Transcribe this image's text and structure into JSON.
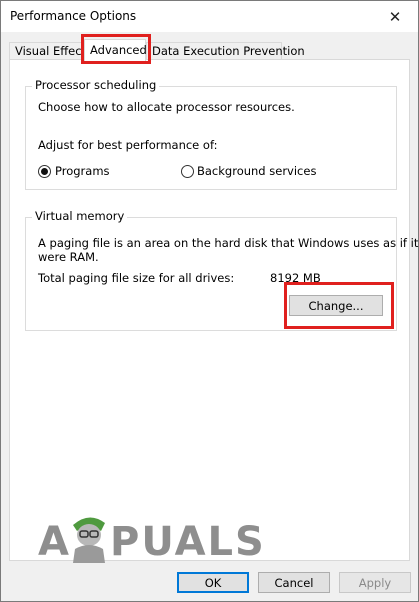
{
  "window": {
    "title": "Performance Options"
  },
  "tabs": [
    {
      "label": "Visual Effects"
    },
    {
      "label": "Advanced"
    },
    {
      "label": "Data Execution Prevention"
    }
  ],
  "processor": {
    "group_title": "Processor scheduling",
    "description": "Choose how to allocate processor resources.",
    "adjust_label": "Adjust for best performance of:",
    "options": [
      {
        "label": "Programs",
        "checked": true
      },
      {
        "label": "Background services",
        "checked": false
      }
    ]
  },
  "virtual_memory": {
    "group_title": "Virtual memory",
    "description_line1": "A paging file is an area on the hard disk that Windows uses as if it",
    "description_line2": "were RAM.",
    "total_label": "Total paging file size for all drives:",
    "total_value": "8192 MB",
    "change_button": "Change..."
  },
  "footer": {
    "ok": "OK",
    "cancel": "Cancel",
    "apply": "Apply"
  },
  "watermark": {
    "left": "A",
    "right": "PUALS"
  },
  "colors": {
    "highlight": "#e0201e",
    "accent": "#0078d7"
  }
}
